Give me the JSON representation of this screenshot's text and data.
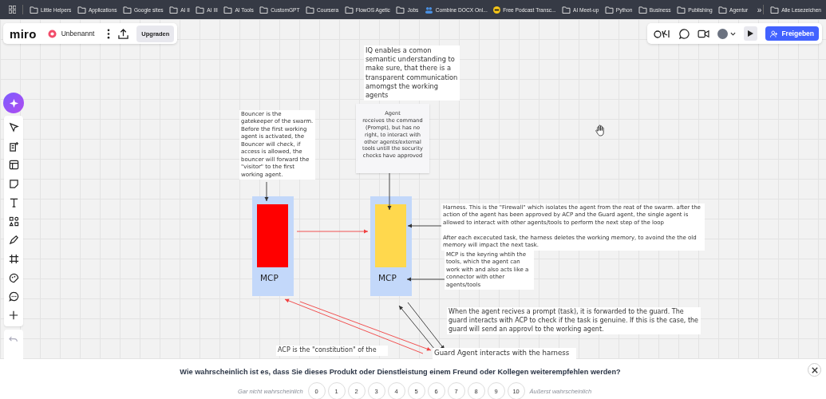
{
  "bookmarks": {
    "items": [
      {
        "label": "Little Helpers",
        "kind": "folder"
      },
      {
        "label": "Applications",
        "kind": "folder"
      },
      {
        "label": "Google sites",
        "kind": "folder"
      },
      {
        "label": "AI II",
        "kind": "folder"
      },
      {
        "label": "AI III",
        "kind": "folder"
      },
      {
        "label": "AI Tools",
        "kind": "folder"
      },
      {
        "label": "CustomGPT",
        "kind": "folder"
      },
      {
        "label": "Coursera",
        "kind": "folder"
      },
      {
        "label": "FlowOS Agetic",
        "kind": "folder"
      },
      {
        "label": "Jobs",
        "kind": "folder"
      },
      {
        "label": "Combine DOCX Onl...",
        "kind": "site"
      },
      {
        "label": "Free Podcast Transc...",
        "kind": "podcast"
      },
      {
        "label": "AI Meet-up",
        "kind": "folder"
      },
      {
        "label": "Python",
        "kind": "folder"
      },
      {
        "label": "Business",
        "kind": "folder"
      },
      {
        "label": "Publishing",
        "kind": "folder"
      },
      {
        "label": "Agentur",
        "kind": "folder"
      }
    ],
    "overflow": "»",
    "all": {
      "label": "Alle Lesezeichen"
    }
  },
  "board": {
    "logo": "miro",
    "name": "Unbenannt",
    "upgrade": "Upgraden",
    "share": "Freigeben"
  },
  "notes": [
    {
      "kind": "text",
      "text": "IQ enables a comon semantic understanding to make sure, that there is a transparent communication amomgst the working agents"
    },
    {
      "kind": "text",
      "text": "Bouncer is the gatekeeper of the swarm. Before the first working agent is activated, the Bouncer will check, if access is allowed, the bouncer will forward the \"visitor\" to the first working agent."
    },
    {
      "kind": "sticky",
      "text": "Agent\nreceives the command (Prompt), but has no right, to interact with other agents/external tools untill the security checks have approved"
    },
    {
      "kind": "text",
      "text": "Harness. This is the \"Firewall\" which isolates the agent from the reat of the swarm. after the action of the agent has been approved by ACP and the Guard agent, the single agent is allowed to interact with other agents/tools to perform the next step of the loop\n\nAfter each excecuted task, the harness deletes the working memory, to avoind the the old memory will impact the next task."
    },
    {
      "kind": "text",
      "text": "MCP is the keyring whtih the tools, which the agent can work with and also acts like a connector with other agents/tools"
    },
    {
      "kind": "text",
      "text": "When the agent recives a prompt (task), it is forwarded to the guard. The guard interacts with ACP to check if the task is genuine. If this is the case, the guard will send an approvl to the working agent."
    },
    {
      "kind": "text",
      "text": "ACP is the \"constitution\" of the"
    },
    {
      "kind": "text",
      "text": "Guard Agent interacts with the harness"
    }
  ],
  "blocks": [
    {
      "label": "MCP",
      "color": "#ff0000"
    },
    {
      "label": "MCP",
      "color": "#ffd84d"
    }
  ],
  "survey": {
    "question": "Wie wahrscheinlich ist es, dass Sie dieses Produkt oder Dienstleistung einem Freund oder Kollegen weiterempfehlen werden?",
    "low_label": "Gar nicht wahrscheinlich",
    "high_label": "Äußerst wahrscheinlich",
    "scale": [
      "0",
      "1",
      "2",
      "3",
      "4",
      "5",
      "6",
      "7",
      "8",
      "9",
      "10"
    ]
  }
}
